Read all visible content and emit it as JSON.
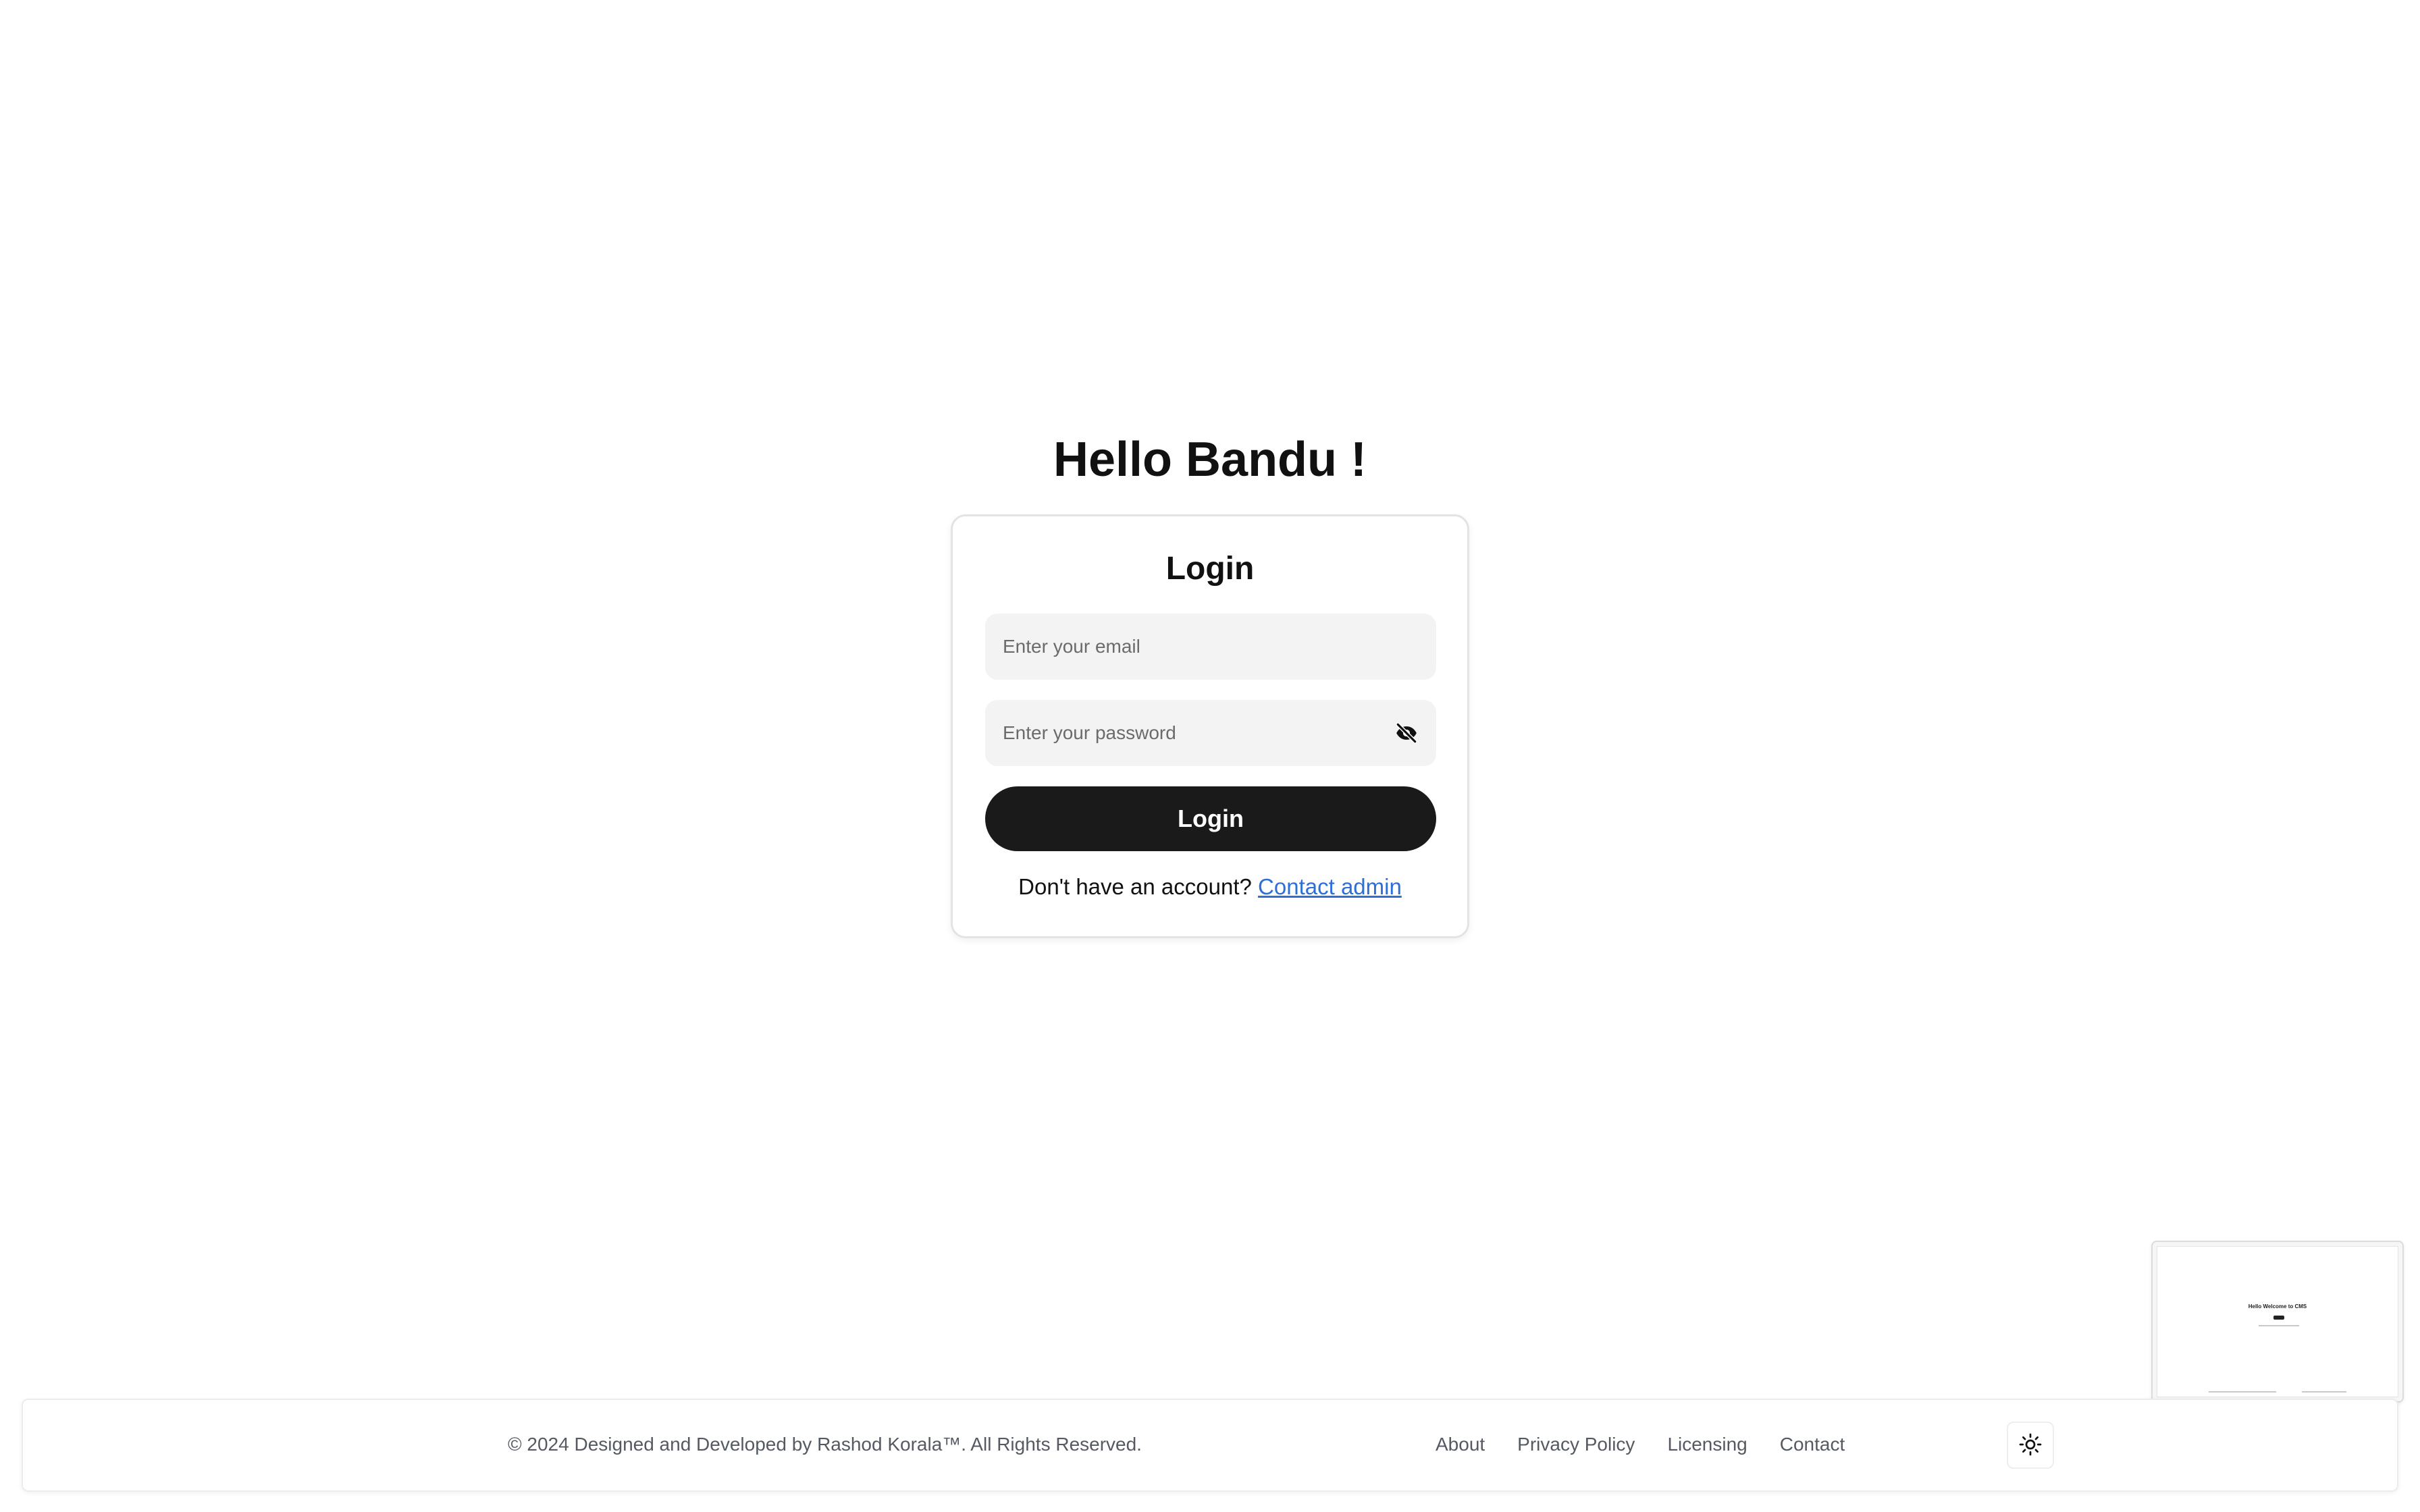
{
  "greeting": "Hello Bandu !",
  "login_card": {
    "title": "Login",
    "email_placeholder": "Enter your email",
    "email_value": "",
    "password_placeholder": "Enter your password",
    "password_value": "",
    "password_toggle_icon": "eye-off-icon",
    "submit_label": "Login",
    "signup_prompt": "Don't have an account?",
    "signup_link": "Contact admin"
  },
  "footer": {
    "copyright": "© 2024 Designed and Developed by Rashod Korala™. All Rights Reserved.",
    "links": [
      "About",
      "Privacy Policy",
      "Licensing",
      "Contact"
    ],
    "theme_toggle_icon": "sun-icon"
  },
  "preview": {
    "title": "Hello Welcome to CMS"
  },
  "colors": {
    "button_bg": "#1a1a1a",
    "field_bg": "#f3f3f3",
    "link": "#2d6fd6",
    "footer_text": "#555a62"
  }
}
